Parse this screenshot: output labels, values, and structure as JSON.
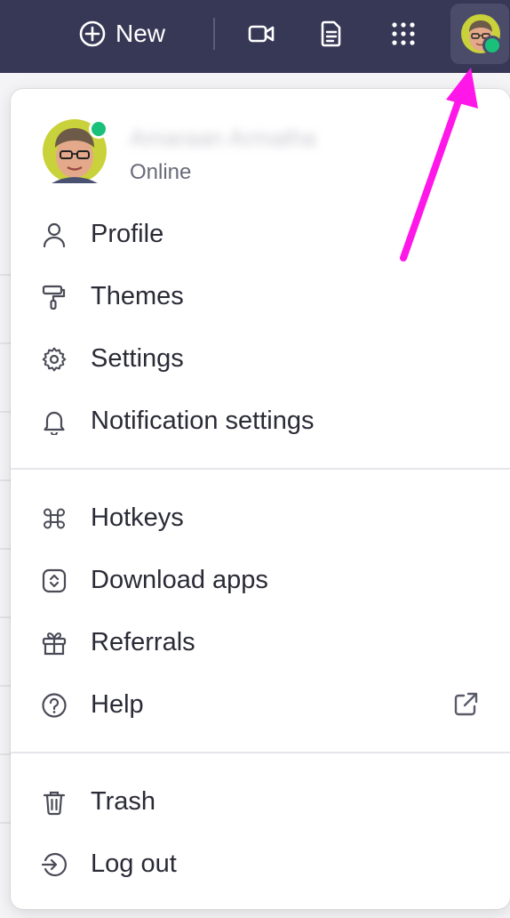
{
  "topbar": {
    "new_label": "New",
    "icons": [
      "plus-circle-icon",
      "video-icon",
      "document-icon",
      "apps-grid-icon"
    ]
  },
  "user": {
    "name": "Amaraan Armatha",
    "status": "Online",
    "status_color": "#19c07a"
  },
  "menu": {
    "group1": [
      {
        "label": "Profile",
        "icon": "person-icon"
      },
      {
        "label": "Themes",
        "icon": "paint-roller-icon"
      },
      {
        "label": "Settings",
        "icon": "gear-icon"
      },
      {
        "label": "Notification settings",
        "icon": "bell-icon"
      }
    ],
    "group2": [
      {
        "label": "Hotkeys",
        "icon": "command-key-icon"
      },
      {
        "label": "Download apps",
        "icon": "download-apps-icon"
      },
      {
        "label": "Referrals",
        "icon": "gift-icon"
      },
      {
        "label": "Help",
        "icon": "help-circle-icon",
        "external": "external-link-icon"
      }
    ],
    "group3": [
      {
        "label": "Trash",
        "icon": "trash-icon"
      },
      {
        "label": "Log out",
        "icon": "log-out-icon"
      }
    ]
  },
  "colors": {
    "topbar_bg": "#373856",
    "annotation_arrow": "#ff16e8"
  }
}
